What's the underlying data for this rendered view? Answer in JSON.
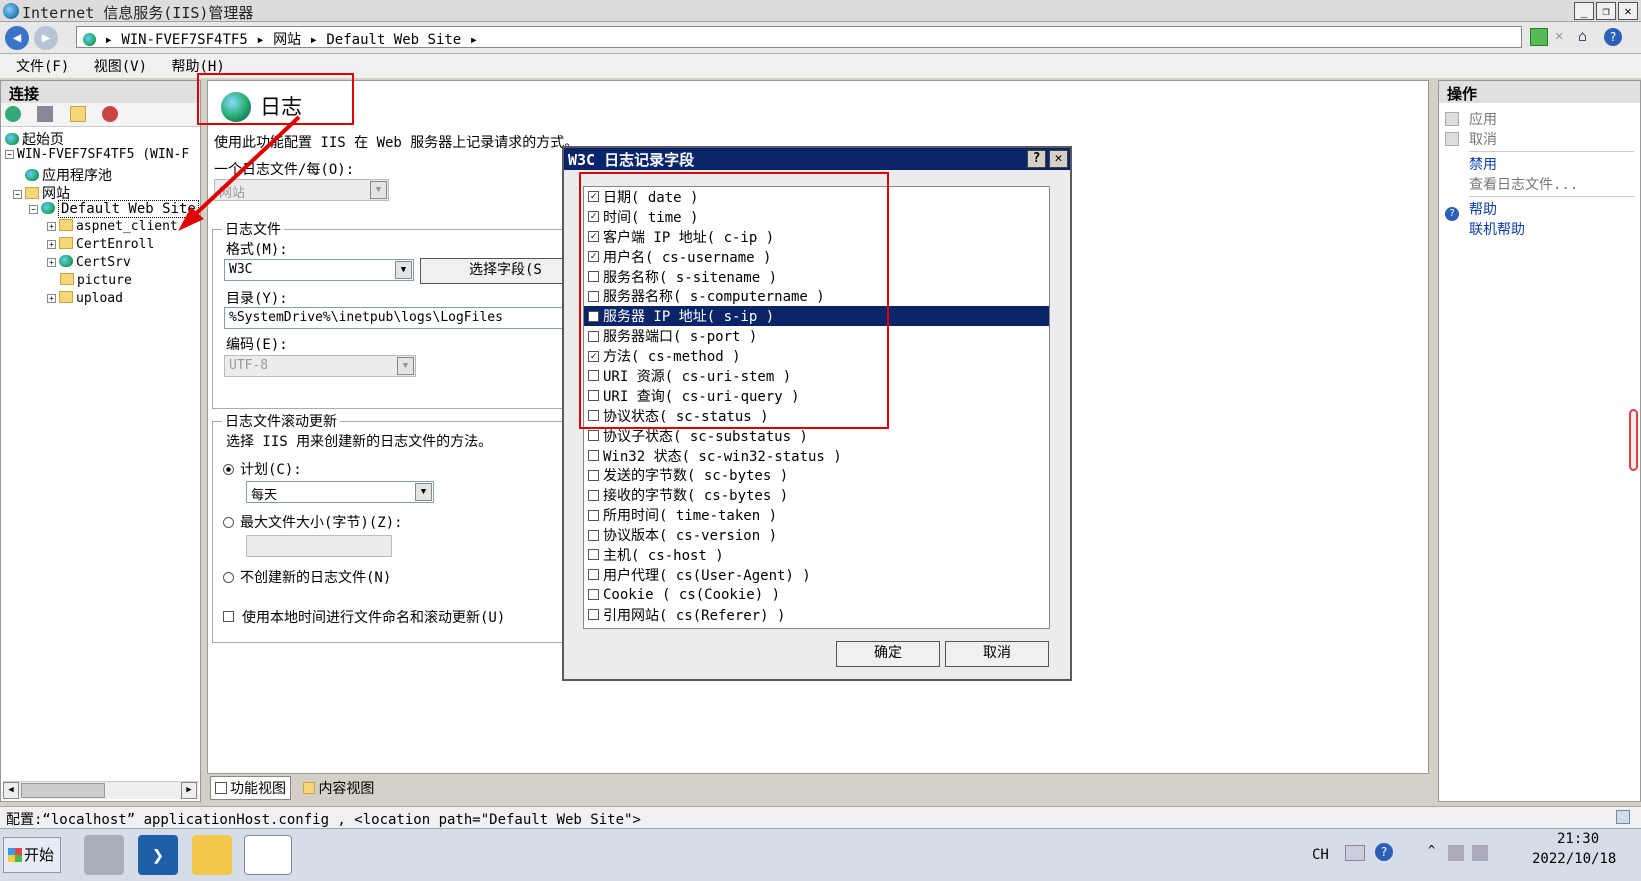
{
  "window": {
    "title": "Internet 信息服务(IIS)管理器"
  },
  "address": {
    "segments": [
      "WIN-FVEF7SF4TF5",
      "网站",
      "Default Web Site"
    ],
    "sep": "▸"
  },
  "menu": [
    "文件(F)",
    "视图(V)",
    "帮助(H)"
  ],
  "left": {
    "title": "连接",
    "tree": {
      "start": "起始页",
      "server": "WIN-FVEF7SF4TF5 (WIN-F",
      "apppools": "应用程序池",
      "sites": "网站",
      "default_site": "Default Web Site",
      "children": [
        "aspnet_client",
        "CertEnroll",
        "CertSrv",
        "picture",
        "upload"
      ]
    }
  },
  "center": {
    "title": "日志",
    "desc": "使用此功能配置 IIS 在 Web 服务器上记录请求的方式。",
    "one_log_label": "一个日志文件/每(O):",
    "one_log_value": "网站",
    "logfile_group": "日志文件",
    "format_label": "格式(M):",
    "format_value": "W3C",
    "select_fields_btn": "选择字段(S",
    "dir_label": "目录(Y):",
    "dir_value": "%SystemDrive%\\inetpub\\logs\\LogFiles",
    "encoding_label": "编码(E):",
    "encoding_value": "UTF-8",
    "rollover_group": "日志文件滚动更新",
    "rollover_desc": "选择 IIS 用来创建新的日志文件的方法。",
    "schedule_label": "计划(C):",
    "schedule_value": "每天",
    "maxsize_label": "最大文件大小(字节)(Z):",
    "nocreate_label": "不创建新的日志文件(N)",
    "localtime_label": "使用本地时间进行文件命名和滚动更新(U)",
    "tabs": [
      "功能视图",
      "内容视图"
    ]
  },
  "right": {
    "title": "操作",
    "apply": "应用",
    "cancel": "取消",
    "disable": "禁用",
    "view_logs": "查看日志文件...",
    "help": "帮助",
    "online_help": "联机帮助"
  },
  "dialog": {
    "title": "W3C 日志记录字段",
    "help_btn": "?",
    "close_btn": "✕",
    "fields": [
      {
        "label": "日期( date )",
        "checked": true
      },
      {
        "label": "时间( time )",
        "checked": true
      },
      {
        "label": "客户端 IP 地址( c-ip )",
        "checked": true
      },
      {
        "label": "用户名( cs-username )",
        "checked": true
      },
      {
        "label": "服务名称( s-sitename )",
        "checked": false
      },
      {
        "label": "服务器名称( s-computername )",
        "checked": false
      },
      {
        "label": "服务器 IP 地址( s-ip )",
        "checked": false,
        "selected": true
      },
      {
        "label": "服务器端口( s-port )",
        "checked": false
      },
      {
        "label": "方法( cs-method )",
        "checked": true
      },
      {
        "label": "URI 资源( cs-uri-stem )",
        "checked": false
      },
      {
        "label": "URI 查询( cs-uri-query )",
        "checked": false
      },
      {
        "label": "协议状态( sc-status )",
        "checked": false
      },
      {
        "label": "协议子状态( sc-substatus )",
        "checked": false
      },
      {
        "label": "Win32 状态( sc-win32-status )",
        "checked": false
      },
      {
        "label": "发送的字节数( sc-bytes )",
        "checked": false
      },
      {
        "label": "接收的字节数( cs-bytes )",
        "checked": false
      },
      {
        "label": "所用时间( time-taken )",
        "checked": false
      },
      {
        "label": "协议版本( cs-version )",
        "checked": false
      },
      {
        "label": "主机( cs-host )",
        "checked": false
      },
      {
        "label": "用户代理( cs(User-Agent) )",
        "checked": false
      },
      {
        "label": "Cookie ( cs(Cookie) )",
        "checked": false
      },
      {
        "label": "引用网站( cs(Referer) )",
        "checked": false
      }
    ],
    "ok": "确定",
    "cancel": "取消"
  },
  "status": "配置:“localhost” applicationHost.config , <location path=\"Default Web Site\">",
  "taskbar": {
    "start": "开始",
    "lang": "CH",
    "time": "21:30",
    "date": "2022/10/18"
  },
  "colors": {
    "highlight_box": "#e00000",
    "selection": "#0a246a",
    "link": "#0b3ea8"
  }
}
